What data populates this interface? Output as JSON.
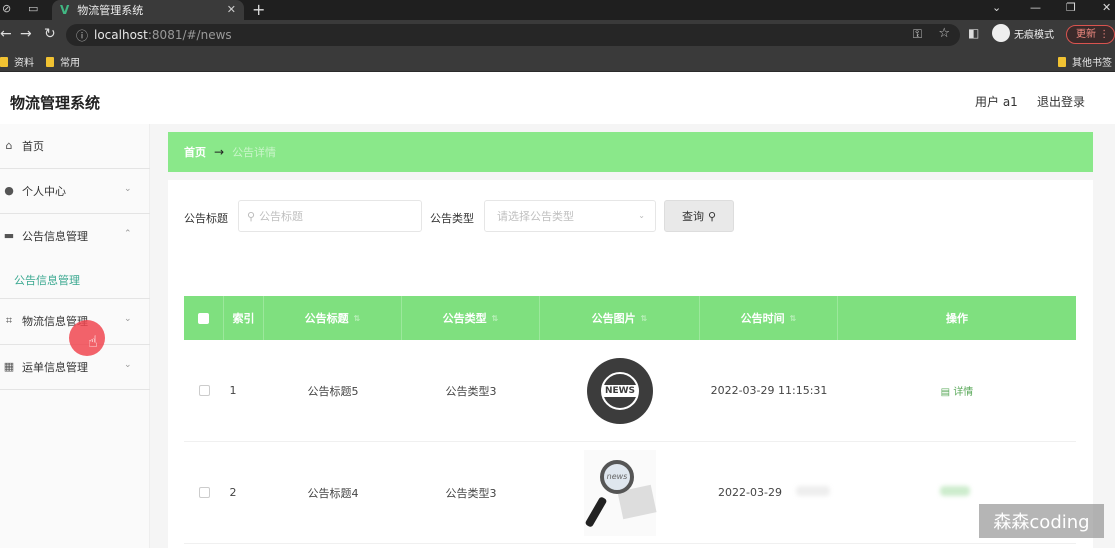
{
  "browser": {
    "tab_title": "物流管理系统",
    "url_host": "localhost",
    "url_path": ":8081/#/news",
    "profile_label": "无痕模式",
    "update_label": "更新",
    "bookmarks": [
      "资料",
      "常用"
    ],
    "other_bookmarks": "其他书签"
  },
  "app": {
    "title": "物流管理系统",
    "user_label": "用户 a1",
    "logout_label": "退出登录"
  },
  "sidebar": {
    "items": [
      {
        "label": "首页",
        "icon": "home-icon"
      },
      {
        "label": "个人中心",
        "icon": "user-icon"
      },
      {
        "label": "公告信息管理",
        "icon": "printer-icon"
      },
      {
        "label": "物流信息管理",
        "icon": "crop-icon"
      },
      {
        "label": "运单信息管理",
        "icon": "grid-icon"
      }
    ],
    "sub_item": "公告信息管理"
  },
  "breadcrumb": {
    "home": "首页",
    "separator": "→",
    "current": "公告详情"
  },
  "search": {
    "title_label": "公告标题",
    "title_placeholder": "公告标题",
    "type_label": "公告类型",
    "type_placeholder": "请选择公告类型",
    "query_label": "查询"
  },
  "table": {
    "headers": [
      "索引",
      "公告标题",
      "公告类型",
      "公告图片",
      "公告时间",
      "操作"
    ],
    "rows": [
      {
        "index": "1",
        "title": "公告标题5",
        "type": "公告类型3",
        "image": "news-globe",
        "time": "2022-03-29 11:15:31",
        "action": "详情"
      },
      {
        "index": "2",
        "title": "公告标题4",
        "type": "公告类型3",
        "image": "news-magnifier",
        "time": "2022-03-29",
        "action": ""
      }
    ]
  },
  "watermark": "森森coding",
  "colors": {
    "accent_green": "#7fe07f",
    "breadcrumb_green": "#8ae88a",
    "submenu_teal": "#3aa890"
  }
}
